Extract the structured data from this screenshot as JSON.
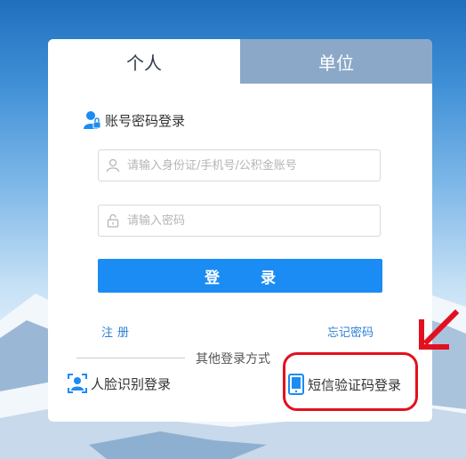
{
  "tabs": [
    {
      "label": "个人",
      "active": true
    },
    {
      "label": "单位",
      "active": false
    }
  ],
  "section_title": "账号密码登录",
  "account_input": {
    "placeholder": "请输入身份证/手机号/公积金账号",
    "value": ""
  },
  "password_input": {
    "placeholder": "请输入密码",
    "value": ""
  },
  "login_button": "登 录",
  "register_link": "注册",
  "forgot_link": "忘记密码",
  "divider_text": "其他登录方式",
  "alt_logins": {
    "face": "人脸识别登录",
    "sms": "短信验证码登录"
  },
  "colors": {
    "primary": "#1a8cf4",
    "inactive_tab": "#8ba8c8",
    "annotation_red": "#e3101e",
    "link": "#2c7fd6"
  },
  "icons": [
    "user-lock-icon",
    "person-icon",
    "lock-icon",
    "face-scan-icon",
    "phone-icon",
    "arrow-icon"
  ]
}
